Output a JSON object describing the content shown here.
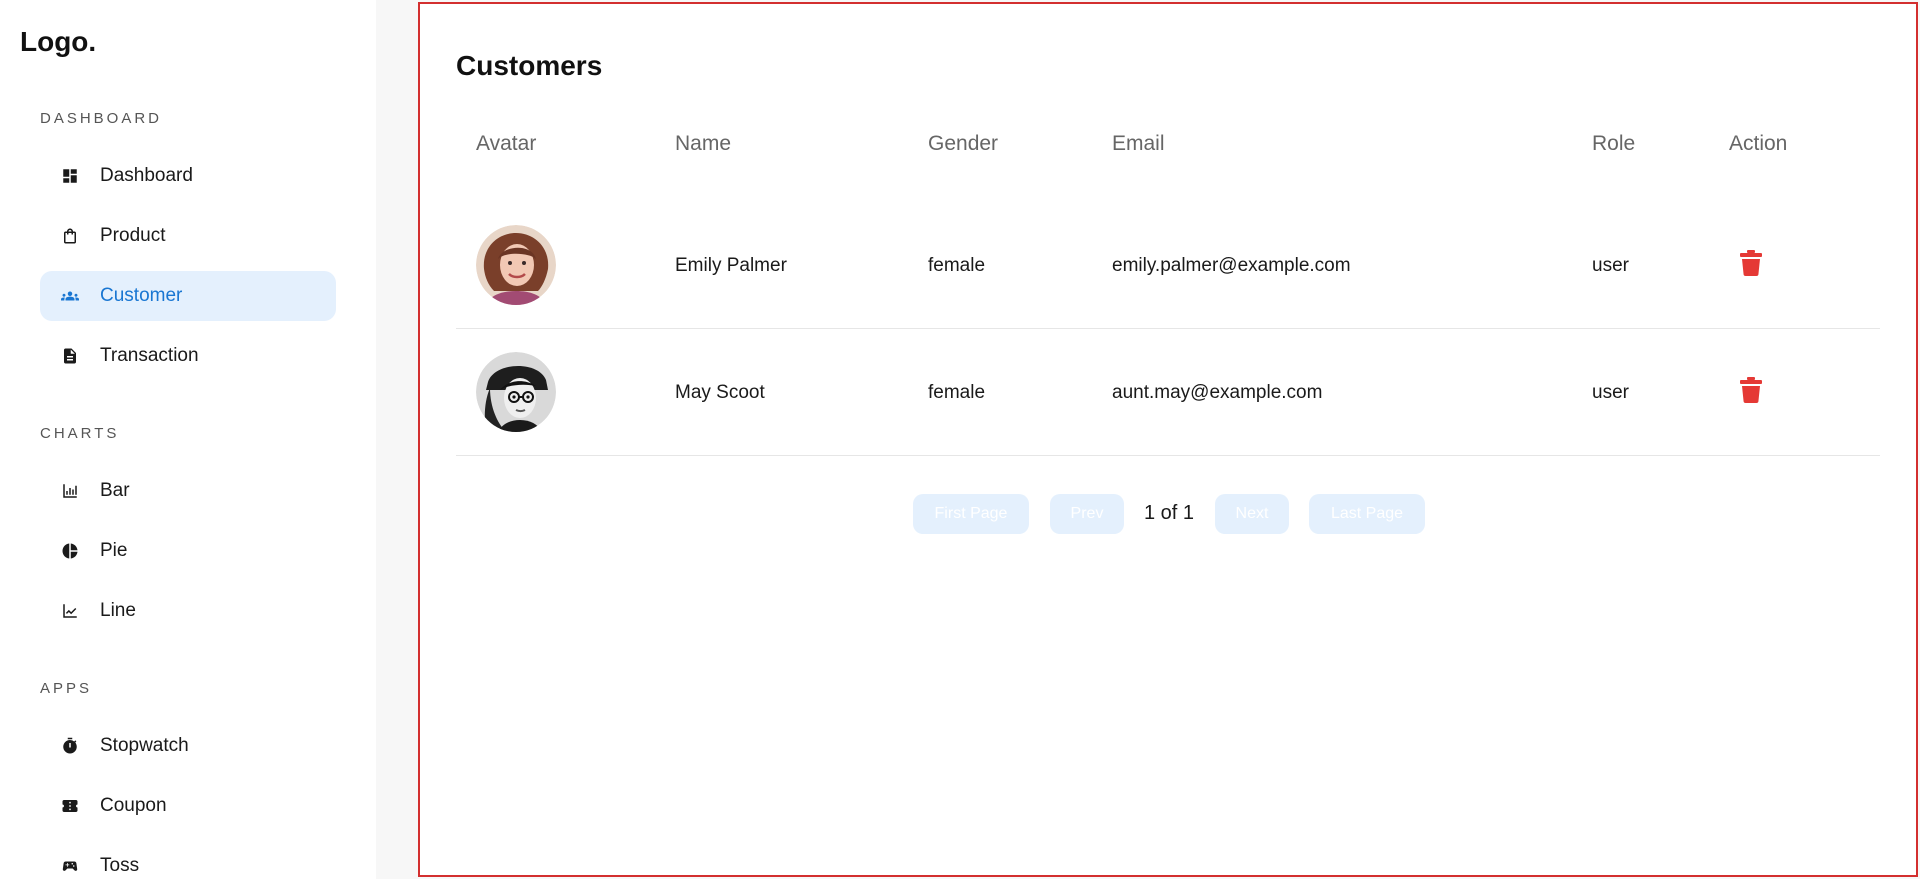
{
  "sidebar": {
    "logo": "Logo.",
    "sections": [
      {
        "title": "DASHBOARD",
        "items": [
          {
            "label": "Dashboard",
            "icon": "dashboard-icon",
            "active": false
          },
          {
            "label": "Product",
            "icon": "shopping-bag-icon",
            "active": false
          },
          {
            "label": "Customer",
            "icon": "people-icon",
            "active": true
          },
          {
            "label": "Transaction",
            "icon": "document-icon",
            "active": false
          }
        ]
      },
      {
        "title": "CHARTS",
        "items": [
          {
            "label": "Bar",
            "icon": "bar-chart-icon",
            "active": false
          },
          {
            "label": "Pie",
            "icon": "pie-chart-icon",
            "active": false
          },
          {
            "label": "Line",
            "icon": "line-chart-icon",
            "active": false
          }
        ]
      },
      {
        "title": "APPS",
        "items": [
          {
            "label": "Stopwatch",
            "icon": "stopwatch-icon",
            "active": false
          },
          {
            "label": "Coupon",
            "icon": "coupon-icon",
            "active": false
          },
          {
            "label": "Toss",
            "icon": "gamepad-icon",
            "active": false
          }
        ]
      }
    ]
  },
  "main": {
    "title": "Customers",
    "columns": [
      "Avatar",
      "Name",
      "Gender",
      "Email",
      "Role",
      "Action"
    ],
    "rows": [
      {
        "name": "Emily Palmer",
        "gender": "female",
        "email": "emily.palmer@example.com",
        "role": "user"
      },
      {
        "name": "May Scoot",
        "gender": "female",
        "email": "aunt.may@example.com",
        "role": "user"
      }
    ],
    "pagination": {
      "first": "First Page",
      "prev": "Prev",
      "status": "1 of 1",
      "next": "Next",
      "last": "Last Page"
    }
  },
  "colors": {
    "accent": "#1976d2",
    "active_bg": "#e4f0fd",
    "delete": "#e53935",
    "frame_border": "#d32f2f"
  }
}
